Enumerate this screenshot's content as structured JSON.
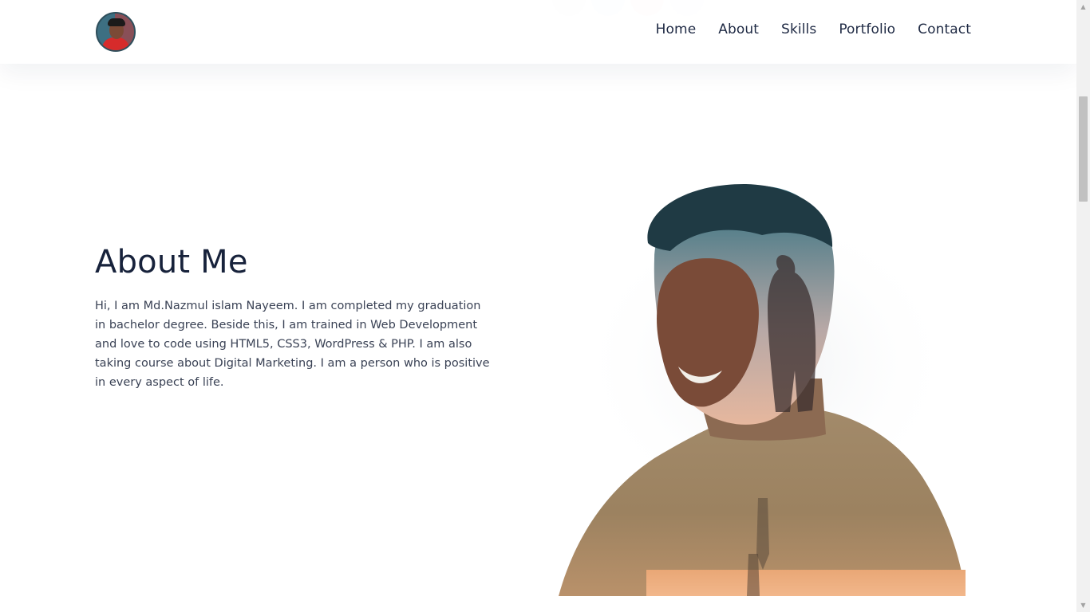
{
  "header": {
    "logo_alt": "Md. Nazmul Islam Nayeem",
    "nav": [
      {
        "label": "Home"
      },
      {
        "label": "About"
      },
      {
        "label": "Skills"
      },
      {
        "label": "Portfolio"
      },
      {
        "label": "Contact"
      }
    ]
  },
  "hero": {
    "social_icons": [
      "facebook-icon",
      "linkedin-icon",
      "youtube-icon",
      "instagram-icon"
    ]
  },
  "about": {
    "title": "About Me",
    "text": "Hi, I am Md.Nazmul islam Nayeem. I am completed my graduation in bachelor degree. Beside this, I am trained in Web Development and love to code using HTML5, CSS3, WordPress & PHP. I am also taking course about Digital Marketing. I am a person who is positive in every aspect of life."
  },
  "colors": {
    "heading": "#17223b",
    "body_text": "#3a4255",
    "nav_text": "#1f2a44",
    "background": "#ffffff"
  }
}
